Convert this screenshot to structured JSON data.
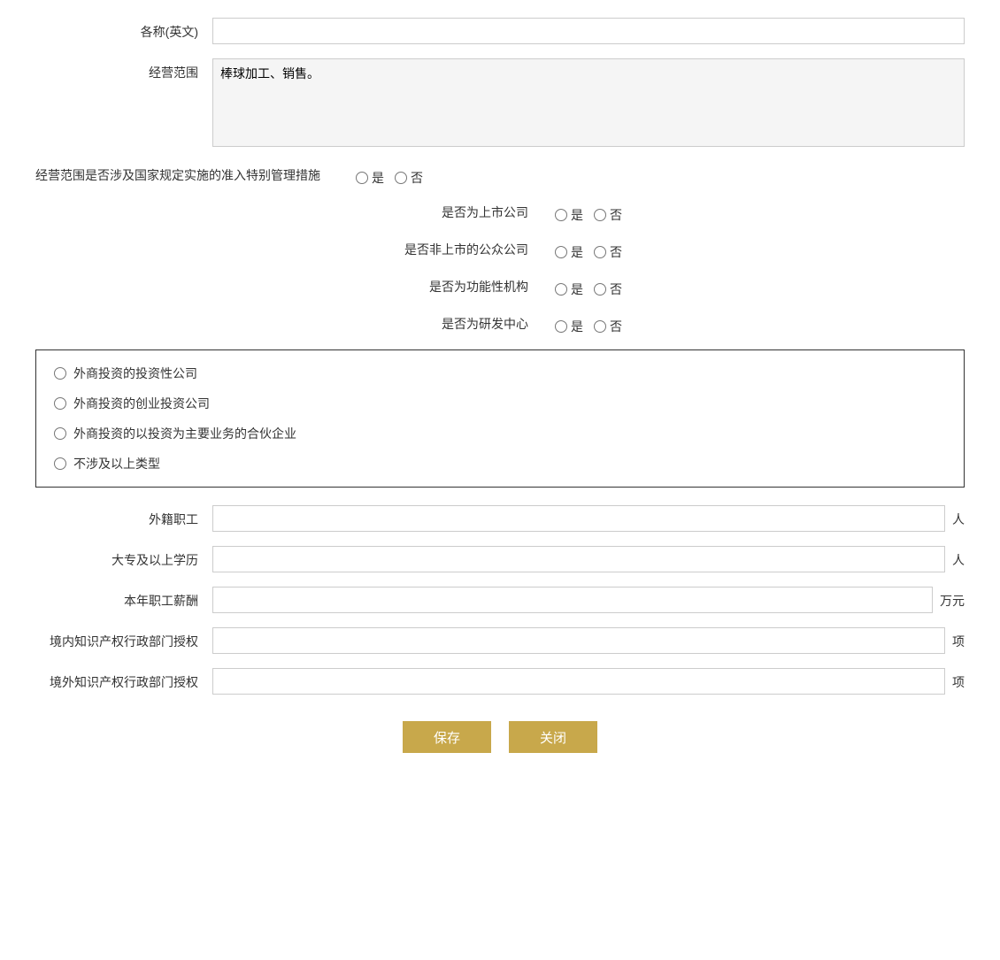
{
  "form": {
    "name_en_label": "各称(英文)",
    "name_en_placeholder": "",
    "business_scope_label": "经营范围",
    "business_scope_value": "棒球加工、销售。",
    "special_mgmt_label": "经营范围是否涉及国家规定实施的准入特别管理措施",
    "special_mgmt_yes": "是",
    "special_mgmt_no": "否",
    "listed_label": "是否为上市公司",
    "listed_yes": "是",
    "listed_no": "否",
    "non_listed_public_label": "是否非上市的公众公司",
    "non_listed_public_yes": "是",
    "non_listed_public_no": "否",
    "functional_org_label": "是否为功能性机构",
    "functional_org_yes": "是",
    "functional_org_no": "否",
    "rd_center_label": "是否为研发中心",
    "rd_center_yes": "是",
    "rd_center_no": "否",
    "foreign_invest_box": {
      "option1": "外商投资的投资性公司",
      "option2": "外商投资的创业投资公司",
      "option3": "外商投资的以投资为主要业务的合伙企业",
      "option4": "不涉及以上类型"
    },
    "foreign_staff_label": "外籍职工",
    "foreign_staff_unit": "人",
    "college_edu_label": "大专及以上学历",
    "college_edu_unit": "人",
    "annual_salary_label": "本年职工薪酬",
    "annual_salary_unit": "万元",
    "domestic_ip_label": "境内知识产权行政部门授权",
    "domestic_ip_unit": "项",
    "foreign_ip_label": "境外知识产权行政部门授权",
    "foreign_ip_unit": "项",
    "save_btn": "保存",
    "close_btn": "关闭"
  }
}
